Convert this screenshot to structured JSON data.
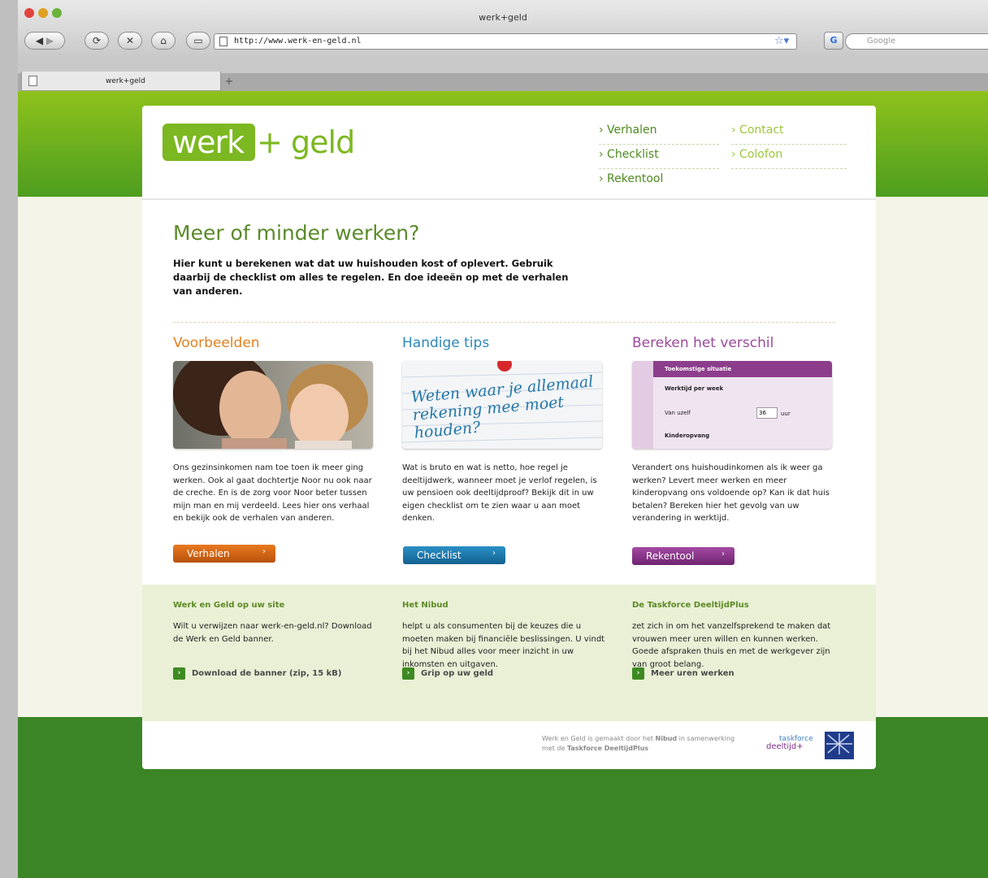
{
  "browser": {
    "window_title": "werk+geld",
    "url": "http://www.werk-en-geld.nl",
    "search_placeholder": "Google",
    "tab_title": "werk+geld",
    "new_tab_label": "+"
  },
  "header": {
    "logo_box": "werk",
    "logo_rest": "+ geld",
    "nav_primary": [
      "› Verhalen",
      "› Checklist",
      "› Rekentool"
    ],
    "nav_secondary": [
      "› Contact",
      "› Colofon"
    ]
  },
  "main": {
    "title": "Meer of minder werken?",
    "intro": "Hier kunt u berekenen wat dat uw huishouden kost of oplevert. Gebruik daarbij de checklist om alles te regelen. En doe ideeën op met de verhalen van anderen.",
    "columns": [
      {
        "heading": "Voorbeelden",
        "text": "Ons gezinsinkomen nam toe toen ik meer ging werken. Ook al gaat dochtertje Noor nu ook naar de creche. En is de zorg voor Noor beter tussen mijn man en mij verdeeld. Lees hier ons verhaal en bekijk ook de verhalen van anderen.",
        "button": "Verhalen"
      },
      {
        "heading": "Handige tips",
        "image_text": "Weten waar je allemaal rekening mee moet houden?",
        "text": "Wat is bruto en wat is netto, hoe regel je deeltijdwerk, wanneer moet je verlof regelen, is uw pensioen ook deeltijdproof? Bekijk dit in uw eigen checklist om te zien waar u aan moet denken.",
        "button": "Checklist"
      },
      {
        "heading": "Bereken het verschil",
        "form_title": "Toekomstige situatie",
        "form_row1": "Werktijd per week",
        "form_label": "Van uzelf",
        "form_value": "36",
        "form_unit": "uur",
        "form_row2": "Kinderopvang",
        "text": "Verandert ons huishoudinkomen als ik weer ga werken? Levert meer werken en meer kinderopvang ons voldoende op? Kan ik dat huis betalen? Bereken hier het gevolg van uw verandering in werktijd.",
        "button": "Rekentool"
      }
    ],
    "button_arrow": "›"
  },
  "info": {
    "columns": [
      {
        "heading": "Werk en Geld op uw site",
        "text": "Wilt u verwijzen naar werk-en-geld.nl? Download de Werk en Geld banner.",
        "link": "Download de banner (zip, 15 kB)"
      },
      {
        "heading": "Het Nibud",
        "text": "helpt u als consumenten bij de keuzes die u moeten maken bij financiële beslissingen. U vindt bij het Nibud alles voor meer inzicht in uw inkomsten en uitgaven.",
        "link": "Grip op uw geld"
      },
      {
        "heading": "De Taskforce DeeltijdPlus",
        "text": "zet zich in om het vanzelfsprekend te maken dat vrouwen meer uren willen en kunnen werken. Goede afspraken thuis en met de werkgever zijn van groot belang.",
        "link": "Meer uren werken"
      }
    ],
    "link_icon": "›"
  },
  "footer": {
    "note_a": "Werk en Geld is gemaakt door het ",
    "note_nibud": "Nibud",
    "note_b": " in samenwerking met de ",
    "note_taskforce": "Taskforce DeeltijdPlus",
    "tf_logo_top": "taskforce",
    "tf_logo_bottom": "deeltijd+"
  },
  "colors": {
    "green": "#7cb821",
    "orange": "#e3801f",
    "blue": "#2e88b8",
    "purple": "#9a4a99",
    "dark_green": "#3c8526"
  }
}
